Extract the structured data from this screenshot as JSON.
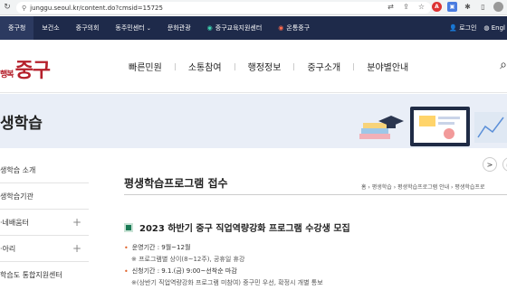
{
  "browser": {
    "url": "junggu.seoul.kr/content.do?cmsid=15725"
  },
  "gov_bar": {
    "items": [
      "중구청",
      "보건소",
      "중구의회",
      "동주민센터",
      "문화관광",
      "중구교육지원센터",
      "온통중구"
    ],
    "login_label": "로그인",
    "lang_label": "Engl"
  },
  "header": {
    "logo_small": "행복",
    "logo_text": "중구",
    "nav": [
      "빠른민원",
      "소통참여",
      "행정정보",
      "중구소개",
      "분야별안내"
    ]
  },
  "banner": {
    "title": "생학습"
  },
  "lnb": {
    "items": [
      {
        "label": "생학습 소개",
        "expand": ""
      },
      {
        "label": "생학습기관",
        "expand": ""
      },
      {
        "label": "·네배움터",
        "expand": "+"
      },
      {
        "label": "·아리",
        "expand": "+"
      },
      {
        "label": "학습도 통합지원센터",
        "expand": ""
      }
    ]
  },
  "content": {
    "page_title": "평생학습프로그램 접수",
    "breadcrumb": "홈 › 평생학습 › 평생학습프로그램 안내 › 평생학습프로",
    "post_title": "2023 하반기 중구 직업역량강화 프로그램 수강생 모집",
    "period_label": "운영기간 : 9월~12월",
    "period_note": "※ 프로그램별 상이(8~12주), 공휴일 휴강",
    "apply_label": "신청기간 : 9.1.(금) 9:00~선착순 마감",
    "apply_note": "※(상반기 직업역량강화 프로그램 미참여) 중구민 우선, 확정시 개별 통보"
  }
}
